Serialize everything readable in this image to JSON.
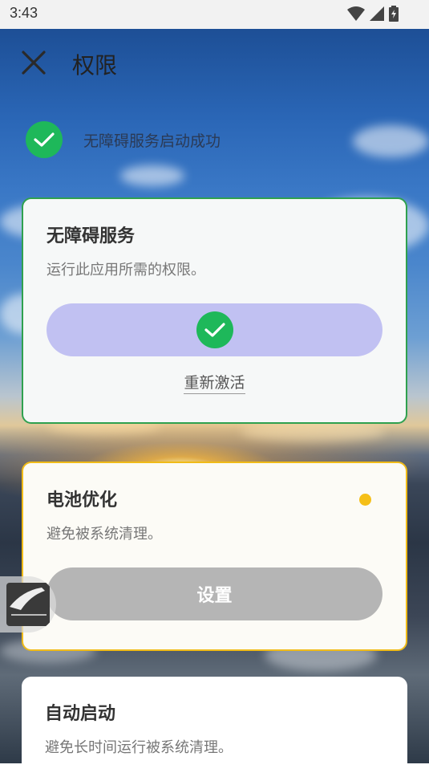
{
  "status_bar": {
    "time": "3:43"
  },
  "header": {
    "title": "权限"
  },
  "success_message": "无障碍服务启动成功",
  "cards": [
    {
      "title": "无障碍服务",
      "description": "运行此应用所需的权限。",
      "action_label": "重新激活",
      "state": "granted"
    },
    {
      "title": "电池优化",
      "description": "避免被系统清理。",
      "button_label": "设置",
      "state": "pending"
    },
    {
      "title": "自动启动",
      "description": "避免长时间运行被系统清理。"
    }
  ],
  "colors": {
    "success_green": "#1eb85a",
    "pending_yellow": "#f5bf18",
    "granted_pill": "#c1c1f2",
    "disabled_button": "#b5b5b5"
  }
}
